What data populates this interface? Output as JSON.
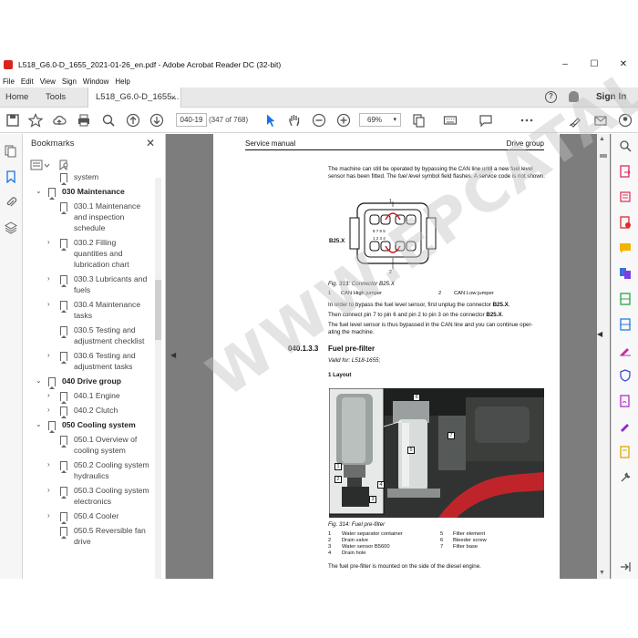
{
  "window": {
    "title": "L518_G6.0-D_1655_2021-01-26_en.pdf - Adobe Acrobat Reader DC (32-bit)",
    "controls": [
      "–",
      "☐",
      "✕"
    ]
  },
  "menu": [
    "File",
    "Edit",
    "View",
    "Sign",
    "Window",
    "Help"
  ],
  "tabs": {
    "home": "Home",
    "tools": "Tools",
    "doc": "L518_G6.0-D_1655...",
    "doc_close": "×",
    "help": "?",
    "signin": "Sign In"
  },
  "toolbar": {
    "page_current": "040-19",
    "page_count": "(347 of 768)",
    "zoom": "69%",
    "zoom_caret": "▾"
  },
  "bookmarks": {
    "header": "Bookmarks",
    "close": "✕",
    "items": [
      {
        "label": "system",
        "indent": 1,
        "twisty": "",
        "bold": false
      },
      {
        "label": "030 Maintenance",
        "indent": 0,
        "twisty": "⌄",
        "bold": true
      },
      {
        "label": "030.1 Maintenance",
        "indent": 1,
        "twisty": "",
        "bold": false
      },
      {
        "label": "and inspection",
        "indent": 1,
        "twisty": "",
        "bold": false,
        "cont": true
      },
      {
        "label": "schedule",
        "indent": 1,
        "twisty": "",
        "bold": false,
        "cont": true
      },
      {
        "label": "030.2 Filling",
        "indent": 1,
        "twisty": "›",
        "bold": false
      },
      {
        "label": "quantities and",
        "indent": 1,
        "twisty": "",
        "bold": false,
        "cont": true
      },
      {
        "label": "lubrication chart",
        "indent": 1,
        "twisty": "",
        "bold": false,
        "cont": true
      },
      {
        "label": "030.3 Lubricants and",
        "indent": 1,
        "twisty": "›",
        "bold": false
      },
      {
        "label": "fuels",
        "indent": 1,
        "twisty": "",
        "bold": false,
        "cont": true
      },
      {
        "label": "030.4 Maintenance",
        "indent": 1,
        "twisty": "›",
        "bold": false
      },
      {
        "label": "tasks",
        "indent": 1,
        "twisty": "",
        "bold": false,
        "cont": true
      },
      {
        "label": "030.5 Testing and",
        "indent": 1,
        "twisty": "",
        "bold": false
      },
      {
        "label": "adjustment checklist",
        "indent": 1,
        "twisty": "",
        "bold": false,
        "cont": true
      },
      {
        "label": "030.6 Testing and",
        "indent": 1,
        "twisty": "›",
        "bold": false
      },
      {
        "label": "adjustment tasks",
        "indent": 1,
        "twisty": "",
        "bold": false,
        "cont": true
      },
      {
        "label": "040 Drive group",
        "indent": 0,
        "twisty": "⌄",
        "bold": true
      },
      {
        "label": "040.1 Engine",
        "indent": 1,
        "twisty": "›",
        "bold": false
      },
      {
        "label": "040.2 Clutch",
        "indent": 1,
        "twisty": "›",
        "bold": false
      },
      {
        "label": "050 Cooling system",
        "indent": 0,
        "twisty": "⌄",
        "bold": true
      },
      {
        "label": "050.1 Overview of",
        "indent": 1,
        "twisty": "",
        "bold": false
      },
      {
        "label": "cooling system",
        "indent": 1,
        "twisty": "",
        "bold": false,
        "cont": true
      },
      {
        "label": "050.2 Cooling system",
        "indent": 1,
        "twisty": "›",
        "bold": false
      },
      {
        "label": "hydraulics",
        "indent": 1,
        "twisty": "",
        "bold": false,
        "cont": true
      },
      {
        "label": "050.3 Cooling system",
        "indent": 1,
        "twisty": "›",
        "bold": false
      },
      {
        "label": "electronics",
        "indent": 1,
        "twisty": "",
        "bold": false,
        "cont": true
      },
      {
        "label": "050.4 Cooler",
        "indent": 1,
        "twisty": "›",
        "bold": false
      },
      {
        "label": "050.5 Reversible fan",
        "indent": 1,
        "twisty": "",
        "bold": false
      },
      {
        "label": "drive",
        "indent": 1,
        "twisty": "",
        "bold": false,
        "cont": true
      }
    ]
  },
  "page": {
    "header_left": "Service manual",
    "header_right": "Drive group",
    "para1_a": "The machine can still be operated by bypassing the CAN line until a new fuel level",
    "para1_b": "sensor has been fitted. The",
    "para1_italic": "fuel level",
    "para1_c": "symbol field flashes. A service code is not",
    "para1_d": "shown.",
    "connector_label": "B25.X",
    "connector_pins_top": "8 7 6 5",
    "connector_pins_bottom": "1 2 3 4",
    "connector_pin1": "1",
    "connector_pin2": "2",
    "fig313": "Fig. 313: Connector B25.X",
    "leg313_1_num": "1",
    "leg313_1": "CAN High jumper",
    "leg313_2_num": "2",
    "leg313_2": "CAN Low jumper",
    "step1_a": "In order to bypass the fuel level sensor, first unplug the connector",
    "step1_b": "B25.X",
    "step1_c": ".",
    "step2_a": "Then connect pin 7 to pin 6 and pin 2 to pin 3 on the connector",
    "step2_b": "B25.X",
    "step2_c": ".",
    "para2_a": "The fuel level sensor is thus bypassed in the CAN line and you can continue oper-",
    "para2_b": "ating the machine.",
    "section_num": "040.1.3.3",
    "section_title": "Fuel pre-filter",
    "valid_for": "Valid for: L518-1655;",
    "layout_heading": "1 Layout",
    "photo_callouts": [
      "1",
      "2",
      "3",
      "4",
      "5",
      "6",
      "7"
    ],
    "fig314": "Fig. 314: Fuel pre-filter",
    "legend314": [
      {
        "num": "1",
        "text": "Water separator container"
      },
      {
        "num": "2",
        "text": "Drain valve"
      },
      {
        "num": "3",
        "text": "Water sensor B5600"
      },
      {
        "num": "4",
        "text": "Drain hole"
      },
      {
        "num": "5",
        "text": "Filter element"
      },
      {
        "num": "6",
        "text": "Bleeder screw"
      },
      {
        "num": "7",
        "text": "Filter base"
      }
    ],
    "para3": "The fuel pre-filter is mounted on the side of the diesel engine.",
    "watermark": "WWW.EPCATALO.COM"
  }
}
